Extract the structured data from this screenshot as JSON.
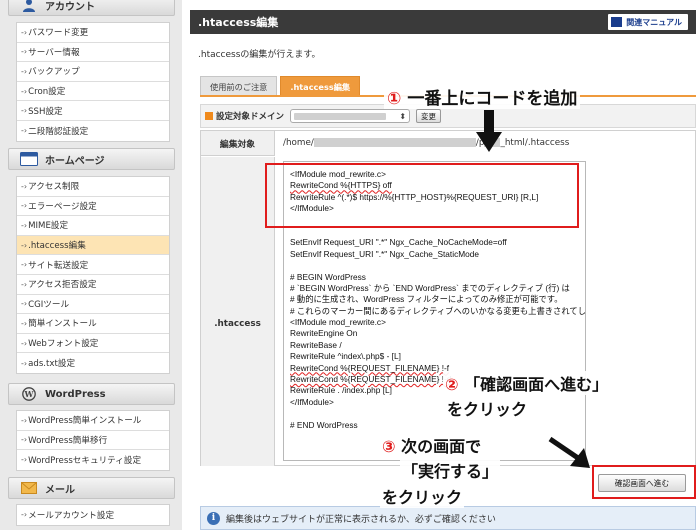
{
  "sidebar": {
    "account": {
      "title": "アカウント",
      "items": [
        "パスワード変更",
        "サーバー情報",
        "バックアップ",
        "Cron設定",
        "SSH設定",
        "二段階認証設定"
      ]
    },
    "homepage": {
      "title": "ホームページ",
      "items": [
        "アクセス制限",
        "エラーページ設定",
        "MIME設定",
        ".htaccess編集",
        "サイト転送設定",
        "アクセス拒否設定",
        "CGIツール",
        "簡単インストール",
        "Webフォント設定",
        "ads.txt設定"
      ],
      "active_index": 3
    },
    "wordpress": {
      "title": "WordPress",
      "items": [
        "WordPress簡単インストール",
        "WordPress簡単移行",
        "WordPressセキュリティ設定"
      ]
    },
    "mail": {
      "title": "メール",
      "items": [
        "メールアカウント設定"
      ]
    }
  },
  "header": {
    "title": ".htaccess編集",
    "manual_label": "関連マニュアル"
  },
  "description": ".htaccessの編集が行えます。",
  "tabs": [
    {
      "label": "使用前のご注意",
      "active": false
    },
    {
      "label": ".htaccess編集",
      "active": true
    }
  ],
  "domain_row": {
    "label": "設定対象ドメイン",
    "change_label": "変更"
  },
  "target": {
    "label": "編集対象",
    "path_prefix": "/home/",
    "path_mid": "/p",
    "path_suffix": "_html/.htaccess"
  },
  "htaccess_label": ".htaccess",
  "editor_lines": [
    "<IfModule mod_rewrite.c>",
    "RewriteCond %{HTTPS} off",
    "RewriteRule ^(.*)$ https://%{HTTP_HOST}%{REQUEST_URI} [R,L]",
    "</IfModule>",
    "",
    "",
    "SetEnvIf Request_URI \".*\" Ngx_Cache_NoCacheMode=off",
    "SetEnvIf Request_URI \".*\" Ngx_Cache_StaticMode",
    "",
    "# BEGIN WordPress",
    "# `BEGIN WordPress` から `END WordPress` までのディレクティブ (行) は",
    "# 動的に生成され、WordPress フィルターによってのみ修正が可能です。",
    "# これらのマーカー間にあるディレクティブへのいかなる変更も上書きされてしまいます。",
    "<IfModule mod_rewrite.c>",
    "RewriteEngine On",
    "RewriteBase /",
    "RewriteRule ^index\\.php$ - [L]",
    "RewriteCond %{REQUEST_FILENAME} !-f",
    "RewriteCond %{REQUEST_FILENAME} !-d",
    "RewriteRule . /index.php [L]",
    "</IfModule>",
    "",
    "# END WordPress"
  ],
  "confirm_button_label": "確認画面へ進む",
  "info_text": "編集後はウェブサイトが正常に表示されるか、必ずご確認ください",
  "annotations": {
    "step1_num": "①",
    "step1_text": "一番上にコードを追加",
    "step2_num": "②",
    "step2_text": "「確認画面へ進む」",
    "step2_text2": "をクリック",
    "step3_num": "③",
    "step3_text": "次の画面で",
    "step3_text2": "「実行する」",
    "step3_text3": "をクリック"
  },
  "colors": {
    "accent_orange": "#ef9a3c",
    "annotation_red": "#e01c1c",
    "header_dark": "#3a3a3a"
  }
}
